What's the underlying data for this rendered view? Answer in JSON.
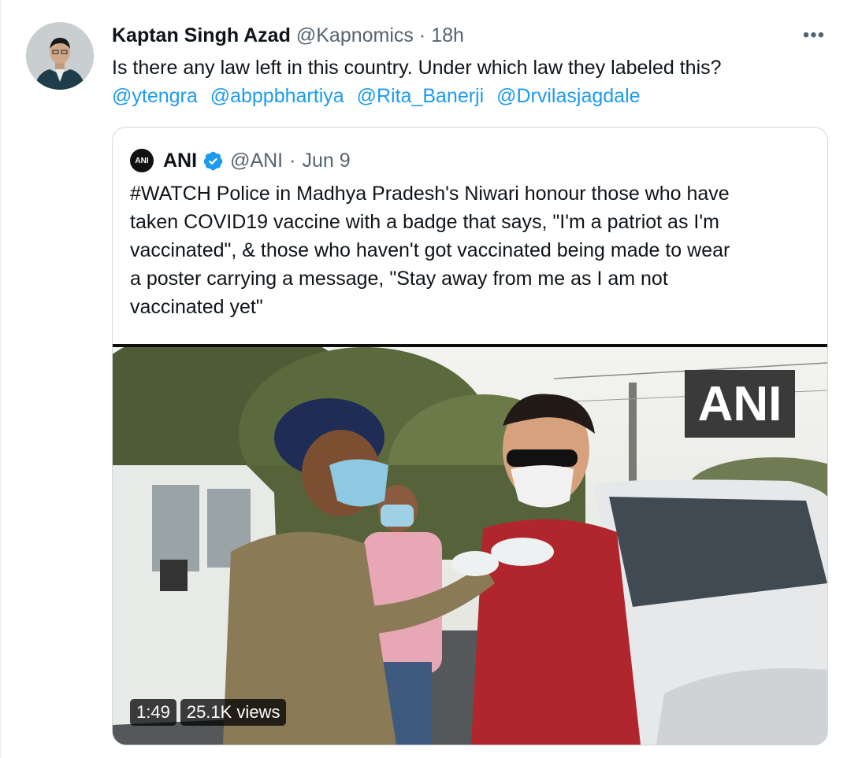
{
  "tweet": {
    "author_name": "Kaptan Singh Azad",
    "author_handle": "@Kapnomics",
    "separator": "·",
    "time": "18h",
    "more_icon": "more-horizontal-icon",
    "more_label": "•••",
    "text": "Is there any law left in this country. Under which law they labeled this?",
    "mentions": [
      "@ytengra",
      "@abppbhartiya",
      "@Rita_Banerji",
      "@Drvilasjagdale"
    ]
  },
  "quote": {
    "avatar_label": "ANI",
    "author_name": "ANI",
    "verified_icon": "verified-badge-icon",
    "author_handle": "@ANI",
    "separator": "·",
    "date": "Jun 9",
    "text_lines": [
      "#WATCH Police in Madhya Pradesh's Niwari honour those who have",
      "taken COVID19 vaccine with a badge that says, \"I'm a patriot as I'm",
      "vaccinated\", & those who haven't got vaccinated being made to wear",
      "a poster carrying a message, \"Stay away from me as I am not",
      "vaccinated yet\""
    ],
    "media": {
      "watermark": "ANI",
      "duration": "1:49",
      "views": "25.1K views"
    }
  },
  "colors": {
    "link": "#1d9bf0",
    "secondary_text": "#536471",
    "border": "#cfd9de"
  }
}
